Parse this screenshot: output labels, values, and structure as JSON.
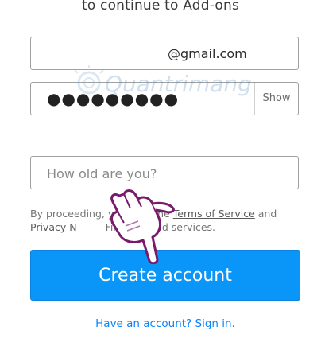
{
  "header": {
    "subtitle": "to continue to Add-ons"
  },
  "form": {
    "email_value": "@gmail.com",
    "password_masked": "●●●●●●●●●",
    "show_label": "Show",
    "age_placeholder": "How old are you?",
    "legal_prefix": "By proceeding, y",
    "legal_mid": "the",
    "terms_link": "Terms of Service",
    "legal_and": "and",
    "privacy_link": "Privacy N",
    "legal_suffix": "Firefox cloud services.",
    "create_label": "Create account",
    "signin_label": "Have an account? Sign in."
  },
  "overlay": {
    "watermark_text": "Quantrimang"
  },
  "colors": {
    "primary_button": "#0996f8",
    "link": "#0a84ff"
  }
}
